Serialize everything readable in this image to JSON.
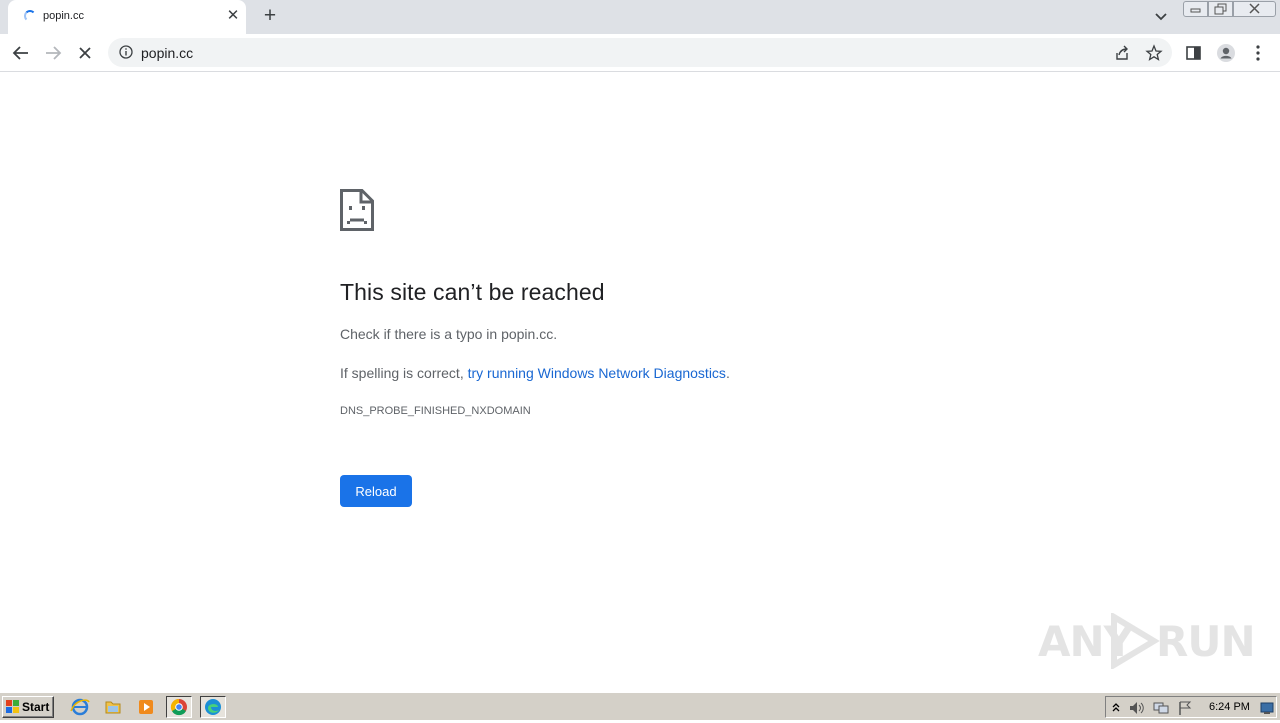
{
  "browser": {
    "tab": {
      "title": "popin.cc",
      "close_glyph": "✕"
    },
    "new_tab_glyph": "+",
    "url": "popin.cc"
  },
  "error_page": {
    "heading": "This site can’t be reached",
    "check_text": "Check if there is a typo in popin.cc.",
    "spelling_prefix": "If spelling is correct, ",
    "diagnostics_link": "try running Windows Network Diagnostics",
    "spelling_suffix": ".",
    "error_code": "DNS_PROBE_FINISHED_NXDOMAIN",
    "reload_label": "Reload"
  },
  "watermark": {
    "left_text": "ANY",
    "right_text": "RUN"
  },
  "taskbar": {
    "start_label": "Start",
    "clock": "6:24 PM"
  },
  "colors": {
    "accent": "#1a73e8",
    "link": "#1967d2"
  }
}
